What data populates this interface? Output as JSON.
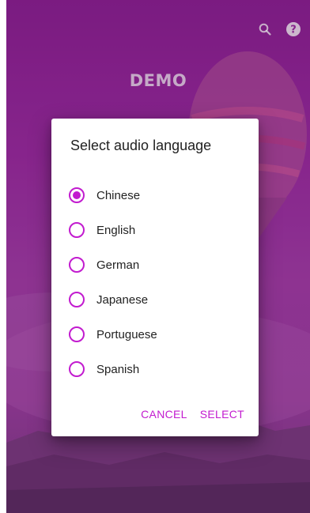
{
  "app": {
    "title": "DEMO",
    "icons": [
      "search-icon",
      "help-icon"
    ]
  },
  "dialog": {
    "title": "Select audio language",
    "options": [
      {
        "label": "Chinese",
        "selected": true
      },
      {
        "label": "English",
        "selected": false
      },
      {
        "label": "German",
        "selected": false
      },
      {
        "label": "Japanese",
        "selected": false
      },
      {
        "label": "Portuguese",
        "selected": false
      },
      {
        "label": "Spanish",
        "selected": false
      }
    ],
    "cancel_label": "CANCEL",
    "select_label": "SELECT"
  },
  "colors": {
    "accent": "#c21bcf",
    "background": "#9a2aa0"
  }
}
